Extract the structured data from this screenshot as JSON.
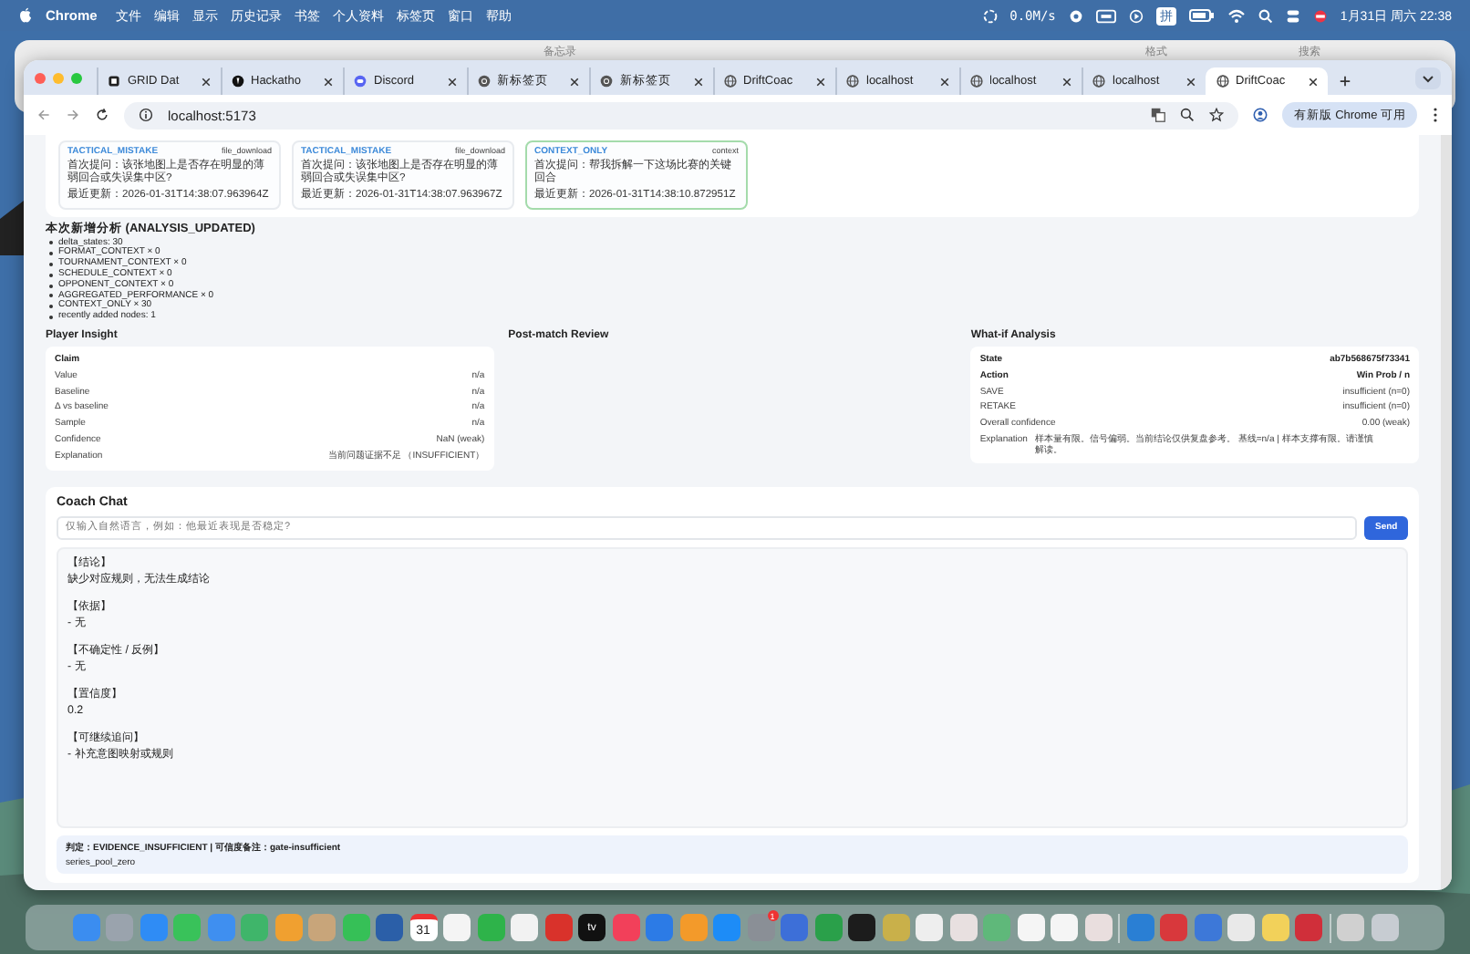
{
  "menu_bar": {
    "app": "Chrome",
    "menus": [
      "文件",
      "编辑",
      "显示",
      "历史记录",
      "书签",
      "个人资料",
      "标签页",
      "窗口",
      "帮助"
    ],
    "net_speed": "0.0M/s",
    "input_method": "拼",
    "clock": "1月31日 周六 22:38"
  },
  "background_window": {
    "title": "备忘录",
    "tools": [
      "格式",
      "搜索"
    ]
  },
  "tabs": [
    {
      "title": "GRID Dat",
      "kind": "grid",
      "selected": false
    },
    {
      "title": "Hackatho",
      "kind": "dark",
      "selected": false
    },
    {
      "title": "Discord",
      "kind": "discord",
      "selected": false
    },
    {
      "title": "新标签页",
      "kind": "chrome",
      "selected": false
    },
    {
      "title": "新标签页",
      "kind": "chrome",
      "selected": false
    },
    {
      "title": "DriftCoac",
      "kind": "globe",
      "selected": false
    },
    {
      "title": "localhost",
      "kind": "globe",
      "selected": false
    },
    {
      "title": "localhost",
      "kind": "globe",
      "selected": false
    },
    {
      "title": "localhost",
      "kind": "globe",
      "selected": false
    },
    {
      "title": "DriftCoac",
      "kind": "globe",
      "selected": true
    }
  ],
  "address_bar": {
    "url": "localhost:5173",
    "update_button": "有新版 Chrome 可用"
  },
  "cards": [
    {
      "label": "TACTICAL_MISTAKE",
      "type": "file_download",
      "question": "首次提问：该张地图上是否存在明显的薄弱回合或失误集中区?",
      "updated": "最近更新：2026-01-31T14:38:07.963964Z",
      "selected": false
    },
    {
      "label": "TACTICAL_MISTAKE",
      "type": "file_download",
      "question": "首次提问：该张地图上是否存在明显的薄弱回合或失误集中区?",
      "updated": "最近更新：2026-01-31T14:38:07.963967Z",
      "selected": false
    },
    {
      "label": "CONTEXT_ONLY",
      "type": "context",
      "question": "首次提问：帮我拆解一下这场比赛的关键回合",
      "updated": "最近更新：2026-01-31T14:38:10.872951Z",
      "selected": true
    }
  ],
  "analysis": {
    "title": "本次新增分析 (ANALYSIS_UPDATED)",
    "items": [
      "delta_states: 30",
      "FORMAT_CONTEXT × 0",
      "TOURNAMENT_CONTEXT × 0",
      "SCHEDULE_CONTEXT × 0",
      "OPPONENT_CONTEXT × 0",
      "AGGREGATED_PERFORMANCE × 0",
      "CONTEXT_ONLY × 30",
      "recently added nodes: 1"
    ]
  },
  "player_insight": {
    "title": "Player Insight",
    "rows": [
      {
        "label": "Claim",
        "value": "",
        "header": true
      },
      {
        "label": "Value",
        "value": "n/a",
        "header": false
      },
      {
        "label": "Baseline",
        "value": "n/a",
        "header": false
      },
      {
        "label": "Δ vs baseline",
        "value": "n/a",
        "header": false
      },
      {
        "label": "Sample",
        "value": "n/a",
        "header": false
      },
      {
        "label": "Confidence",
        "value": "NaN (weak)",
        "header": false
      },
      {
        "label": "Explanation",
        "value": "当前问题证据不足 （INSUFFICIENT）",
        "header": false
      }
    ]
  },
  "post_match": {
    "title": "Post-match Review"
  },
  "what_if": {
    "title": "What-if Analysis",
    "rows": [
      {
        "label": "State",
        "value": "ab7b568675f73341",
        "header": true
      },
      {
        "label": "Action",
        "value": "Win Prob / n",
        "header": true
      },
      {
        "label": "SAVE",
        "value": "insufficient (n=0)",
        "header": false
      },
      {
        "label": "RETAKE",
        "value": "insufficient (n=0)",
        "header": false
      },
      {
        "label": "Overall confidence",
        "value": "0.00 (weak)",
        "header": false
      }
    ],
    "explanation_label": "Explanation",
    "explanation": "样本量有限。信号偏弱。当前结论仅供复盘参考。 基线=n/a | 样本支撑有限。请谨慎解读。"
  },
  "coach_chat": {
    "title": "Coach Chat",
    "placeholder": "仅输入自然语言，例如：他最近表现是否稳定?",
    "send": "Send",
    "sections": [
      {
        "heading": "【结论】",
        "body": "缺少对应规则，无法生成结论"
      },
      {
        "heading": "【依据】",
        "body": "- 无"
      },
      {
        "heading": "【不确定性 / 反例】",
        "body": "- 无"
      },
      {
        "heading": "【置信度】",
        "body": "0.2"
      },
      {
        "heading": "【可继续追问】",
        "body": "- 补充意图映射或规则"
      }
    ],
    "verdict": "判定：EVIDENCE_INSUFFICIENT | 可信度备注：gate-insufficient",
    "verdict_note": "series_pool_zero"
  },
  "dock": {
    "calendar_day": "31",
    "tv_label": "tv",
    "badge": "1"
  }
}
